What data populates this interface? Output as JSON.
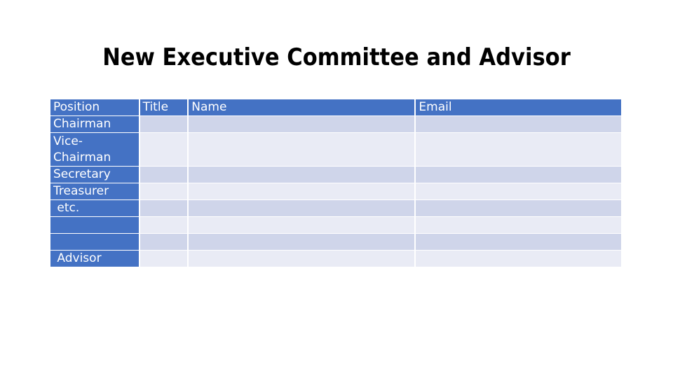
{
  "slide": {
    "title": "New Executive Committee and Advisor"
  },
  "table": {
    "headers": [
      "Position",
      "Title",
      "Name",
      "Email"
    ],
    "rows": [
      {
        "position": "Chairman",
        "title": "",
        "name": "",
        "email": ""
      },
      {
        "position": "Vice-Chairman",
        "title": "",
        "name": "",
        "email": ""
      },
      {
        "position": "Secretary",
        "title": "",
        "name": "",
        "email": ""
      },
      {
        "position": "Treasurer",
        "title": "",
        "name": "",
        "email": ""
      },
      {
        "position": " etc.",
        "title": "",
        "name": "",
        "email": ""
      },
      {
        "position": "",
        "title": "",
        "name": "",
        "email": ""
      },
      {
        "position": "",
        "title": "",
        "name": "",
        "email": ""
      },
      {
        "position": " Advisor",
        "title": "",
        "name": "",
        "email": ""
      }
    ]
  },
  "colors": {
    "header": "#4472c4",
    "band_dark": "#cfd5ea",
    "band_light": "#e9ebf5"
  }
}
